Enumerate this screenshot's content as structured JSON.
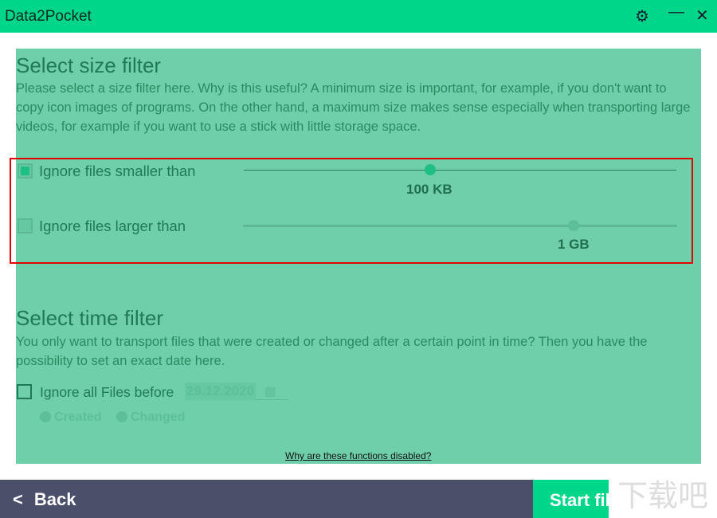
{
  "app": {
    "title": "Data2Pocket",
    "settings_icon": "gear-icon",
    "minimize_icon": "minimize-icon",
    "close_icon": "close-icon"
  },
  "size_filter": {
    "title": "Select size filter",
    "description": "Please select a size filter here. Why is this useful? A minimum size is important, for example, if you don't want to copy icon images of programs. On the other hand, a maximum size makes sense especially when transporting large videos, for example if you want to use a stick with little storage space.",
    "min": {
      "label": "Ignore files smaller than",
      "checked": true,
      "value": "100 KB",
      "slider_percent": 43
    },
    "max": {
      "label": "Ignore files larger than",
      "checked": false,
      "value": "1 GB",
      "slider_percent": 76
    }
  },
  "time_filter": {
    "title": "Select time filter",
    "description": "You only want to transport files that were created or changed after a certain point in time? Then you have the possibility to set an exact date here.",
    "label": "Ignore all Files before",
    "checked": false,
    "date": "29.12.2020",
    "options": [
      "Created",
      "Changed"
    ],
    "selected": "Created"
  },
  "disabled_link": "Why are these functions disabled?",
  "footer": {
    "back": "Back",
    "start": "Start file"
  },
  "watermark": "下载吧 www.xiazaiba.com",
  "colors": {
    "accent": "#00d68a",
    "overlay": "#70cfab",
    "footer": "#4b4f6a",
    "highlight": "#e00000"
  }
}
